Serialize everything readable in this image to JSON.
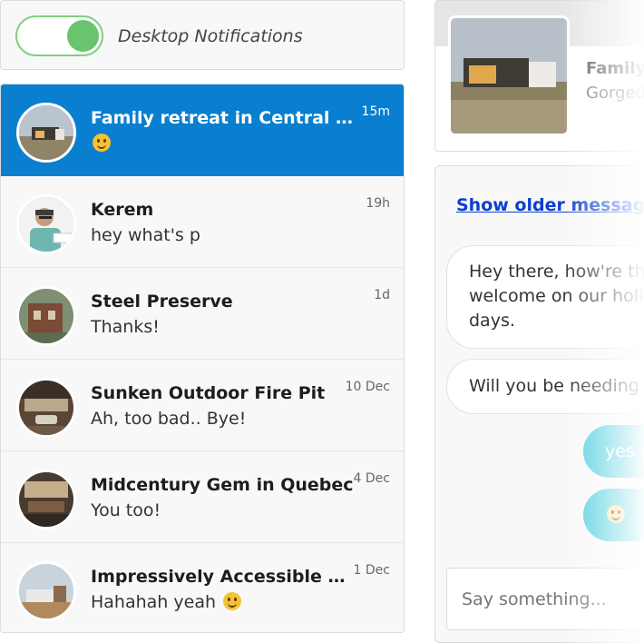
{
  "notifications": {
    "label": "Desktop Notifications",
    "enabled": true,
    "toggle_color": "#69c46d"
  },
  "conversations": [
    {
      "name": "Family retreat in Central M...",
      "preview": "",
      "emoji": "smile-emoji",
      "time": "15m",
      "active": true
    },
    {
      "name": "Kerem",
      "preview": "hey what's p",
      "time": "19h",
      "active": false
    },
    {
      "name": "Steel Preserve",
      "preview": "Thanks!",
      "time": "1d",
      "active": false
    },
    {
      "name": "Sunken Outdoor Fire Pit",
      "preview": "Ah, too bad.. Bye!",
      "time": "10 Dec",
      "active": false
    },
    {
      "name": "Midcentury Gem in Quebec",
      "preview": "You too!",
      "time": "4 Dec",
      "active": false
    },
    {
      "name": "Impressively Accessible H...",
      "preview": "Hahahah yeah",
      "emoji": "smile-emoji",
      "time": "1 Dec",
      "active": false
    }
  ],
  "listing": {
    "title": "Family",
    "subtitle": "Gorged"
  },
  "chat": {
    "show_older_label": "Show older message",
    "messages": [
      {
        "from": "host",
        "text_lines": [
          "Hey there, how're th",
          "welcome on our holi",
          "days."
        ]
      },
      {
        "from": "host",
        "text_lines": [
          "Will you be needing"
        ]
      },
      {
        "from": "me",
        "text": "yes p"
      },
      {
        "from": "me",
        "emoji": "smile-emoji"
      }
    ],
    "input_placeholder": "Say something..."
  },
  "colors": {
    "active_row": "#0a7fcf",
    "outgoing_bubble": "#52cfe0",
    "link": "#0a3fd0"
  }
}
